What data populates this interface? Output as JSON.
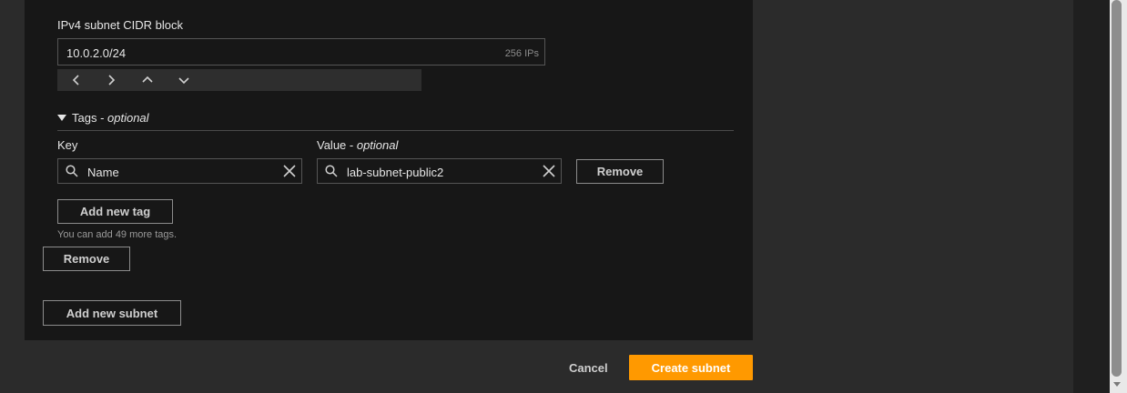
{
  "cidr": {
    "label": "IPv4 subnet CIDR block",
    "value": "10.0.2.0/24",
    "ip_count": "256 IPs"
  },
  "tags": {
    "header_prefix": "Tags - ",
    "header_optional": "optional",
    "key_label": "Key",
    "value_label_prefix": "Value - ",
    "value_label_optional": "optional",
    "key_value": "Name",
    "value_value": "lab-subnet-public2",
    "remove_tag_label": "Remove",
    "add_tag_label": "Add new tag",
    "remaining_hint": "You can add 49 more tags."
  },
  "subnet": {
    "remove_label": "Remove",
    "add_subnet_label": "Add new subnet"
  },
  "footer": {
    "cancel_label": "Cancel",
    "create_label": "Create subnet"
  },
  "colors": {
    "primary": "#ff9900",
    "card_bg": "#171717",
    "page_bg": "#2b2b2b"
  }
}
